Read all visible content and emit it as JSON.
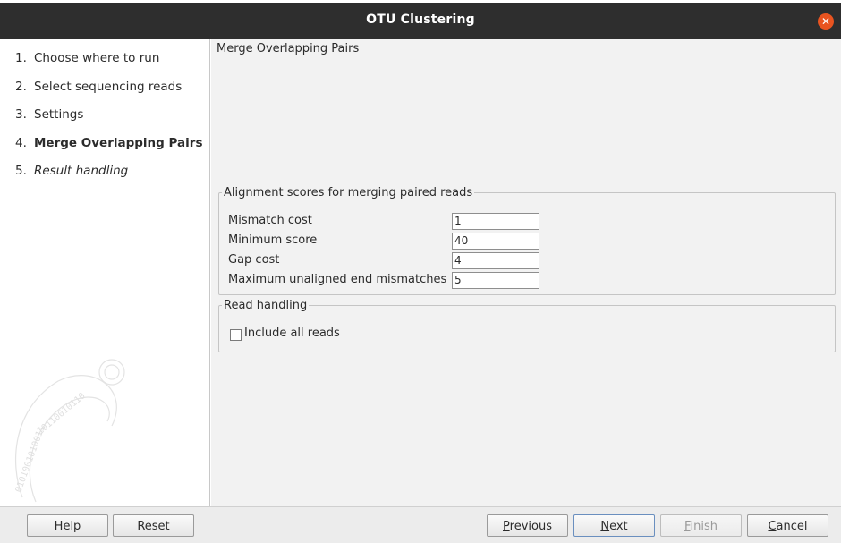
{
  "window": {
    "title": "OTU Clustering"
  },
  "steps": [
    {
      "num": "1.",
      "label": "Choose where to run"
    },
    {
      "num": "2.",
      "label": "Select sequencing reads"
    },
    {
      "num": "3.",
      "label": "Settings"
    },
    {
      "num": "4.",
      "label": "Merge Overlapping Pairs"
    },
    {
      "num": "5.",
      "label": "Result handling"
    }
  ],
  "content": {
    "title": "Merge Overlapping Pairs",
    "alignment_group": {
      "legend": "Alignment scores for merging paired reads",
      "fields": [
        {
          "label": "Mismatch cost",
          "value": "1"
        },
        {
          "label": "Minimum score",
          "value": "40"
        },
        {
          "label": "Gap cost",
          "value": "4"
        },
        {
          "label": "Maximum unaligned end mismatches",
          "value": "5"
        }
      ]
    },
    "read_group": {
      "legend": "Read handling",
      "checkbox_label": "Include all reads",
      "checked": false
    }
  },
  "buttons": {
    "help": "Help",
    "reset": "Reset",
    "previous_u": "P",
    "previous_rest": "revious",
    "next_u": "N",
    "next_rest": "ext",
    "finish_u": "F",
    "finish_rest": "inish",
    "cancel_u": "C",
    "cancel_rest": "ancel"
  },
  "colors": {
    "titlebar": "#2e2e2e",
    "close": "#e95420",
    "panel": "#f2f2f2"
  }
}
